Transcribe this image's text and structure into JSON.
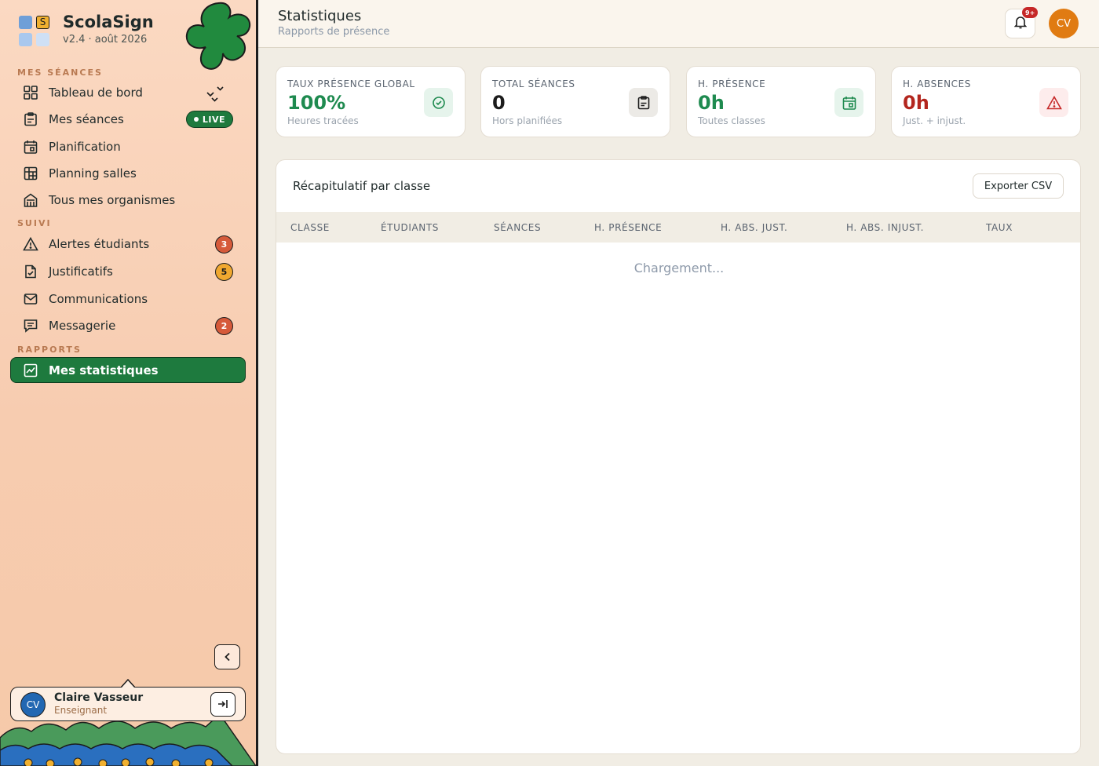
{
  "app": {
    "name": "ScolaSign",
    "version": "v2.4 · août 2026",
    "logo_letter": "S"
  },
  "sidebar": {
    "sections": [
      {
        "title": "MES SÉANCES"
      },
      {
        "title": "SUIVI"
      },
      {
        "title": "RAPPORTS"
      }
    ],
    "items": [
      {
        "label": "Tableau de bord",
        "icon": "dashboard-grid-icon"
      },
      {
        "label": "Mes séances",
        "icon": "clipboard-icon",
        "tag": "LIVE"
      },
      {
        "label": "Planification",
        "icon": "calendar-icon"
      },
      {
        "label": "Planning salles",
        "icon": "grid-table-icon"
      },
      {
        "label": "Tous mes organismes",
        "icon": "building-icon"
      },
      {
        "label": "Alertes étudiants",
        "icon": "warning-icon",
        "badge": "3"
      },
      {
        "label": "Justificatifs",
        "icon": "document-check-icon",
        "badge": "5"
      },
      {
        "label": "Communications",
        "icon": "mail-icon"
      },
      {
        "label": "Messagerie",
        "icon": "message-icon",
        "badge": "2"
      },
      {
        "label": "Mes statistiques",
        "icon": "chart-icon",
        "active": true
      }
    ]
  },
  "user": {
    "initials": "CV",
    "name": "Claire Vasseur",
    "role": "Enseignant"
  },
  "header": {
    "title": "Statistiques",
    "subtitle": "Rapports de présence",
    "notification_count": "9+",
    "avatar_initials": "CV"
  },
  "stats": [
    {
      "label": "TAUX PRÉSENCE GLOBAL",
      "value": "100%",
      "sub": "Heures tracées",
      "color": "#1e8a4f",
      "icon": "check-circle-icon",
      "icon_bg": "#e6f4ec"
    },
    {
      "label": "TOTAL SÉANCES",
      "value": "0",
      "sub": "Hors planifiées",
      "color": "#1c1c1c",
      "icon": "clipboard-icon",
      "icon_bg": "#eceae6"
    },
    {
      "label": "H. PRÉSENCE",
      "value": "0h",
      "sub": "Toutes classes",
      "color": "#1e8a4f",
      "icon": "calendar-icon",
      "icon_bg": "#e6f4ec"
    },
    {
      "label": "H. ABSENCES",
      "value": "0h",
      "sub": "Just. + injust.",
      "color": "#b3261e",
      "icon": "warning-icon",
      "icon_bg": "#fdecec"
    }
  ],
  "summary": {
    "title": "Récapitulatif par classe",
    "export_label": "Exporter CSV",
    "columns": [
      "CLASSE",
      "ÉTUDIANTS",
      "SÉANCES",
      "H. PRÉSENCE",
      "H. ABS. JUST.",
      "H. ABS. INJUST.",
      "TAUX"
    ],
    "loading_text": "Chargement..."
  },
  "colors": {
    "accent_green": "#1e7a3e",
    "badge_red": "#d65a3a",
    "badge_amber": "#f0a830",
    "avatar_orange": "#e07b12"
  }
}
